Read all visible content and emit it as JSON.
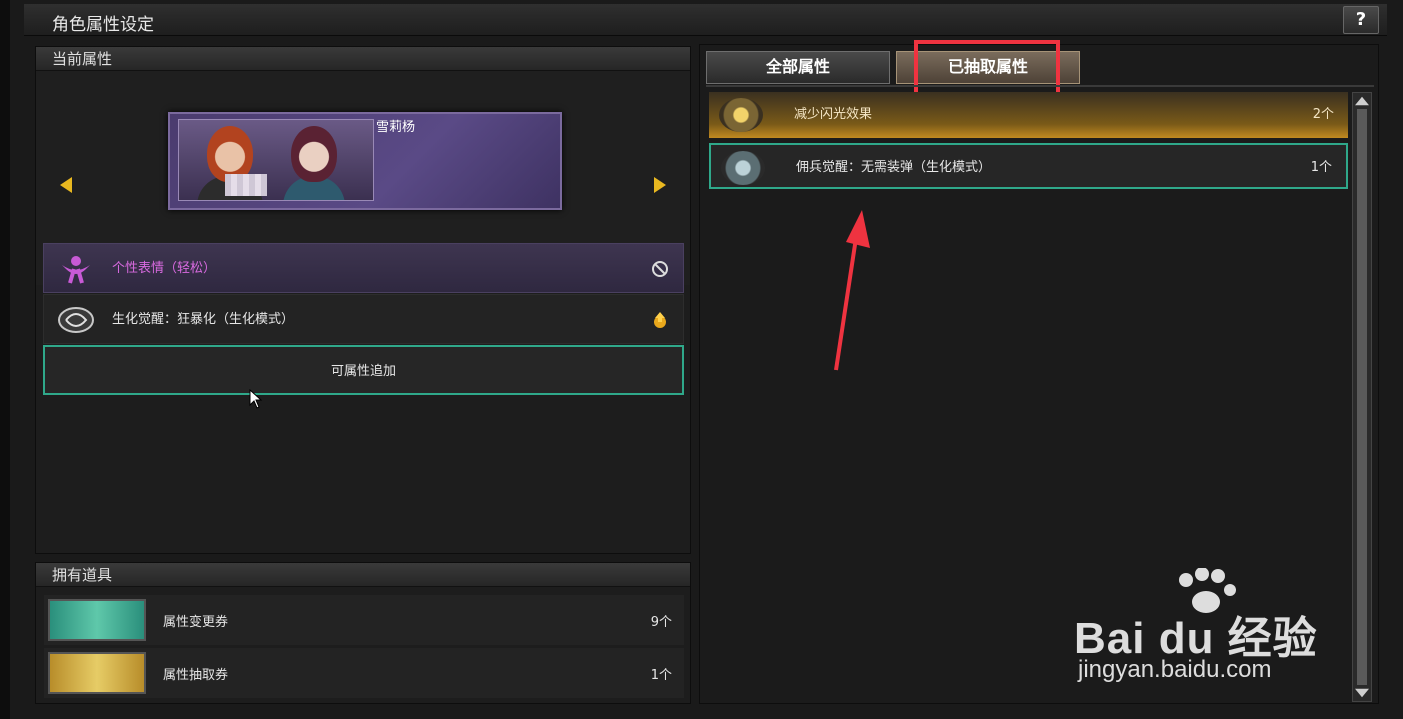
{
  "window": {
    "title": "角色属性设定",
    "help_label": "?"
  },
  "current_attributes": {
    "header": "当前属性",
    "character_name": "雪莉杨",
    "rows": [
      {
        "label": "个性表情（轻松）",
        "icon": "emote-icon",
        "status_icon": "prohibited-icon"
      },
      {
        "label": "生化觉醒：狂暴化（生化模式）",
        "icon": "bio-awaken-icon",
        "status_icon": "upgrade-icon"
      }
    ],
    "add_label": "可属性追加"
  },
  "owned_items": {
    "header": "拥有道具",
    "items": [
      {
        "name": "属性变更券",
        "count": "9个",
        "icon": "change-ticket-icon"
      },
      {
        "name": "属性抽取券",
        "count": "1个",
        "icon": "extract-ticket-icon"
      }
    ]
  },
  "right_panel": {
    "tabs": [
      {
        "label": "全部属性",
        "selected": false
      },
      {
        "label": "已抽取属性",
        "selected": true
      }
    ],
    "list": [
      {
        "label": "减少闪光效果",
        "count": "2个",
        "icon": "flash-reduce-icon"
      },
      {
        "label": "佣兵觉醒：无需装弹（生化模式）",
        "count": "1个",
        "icon": "mercenary-awaken-icon"
      }
    ]
  },
  "watermark": {
    "logo": "Bai du 经验",
    "url": "jingyan.baidu.com"
  },
  "colors": {
    "accent_teal": "#2fa88a",
    "highlight_red": "#ef3340",
    "arrow_yellow": "#e9b820",
    "purple_text": "#d86adf"
  }
}
